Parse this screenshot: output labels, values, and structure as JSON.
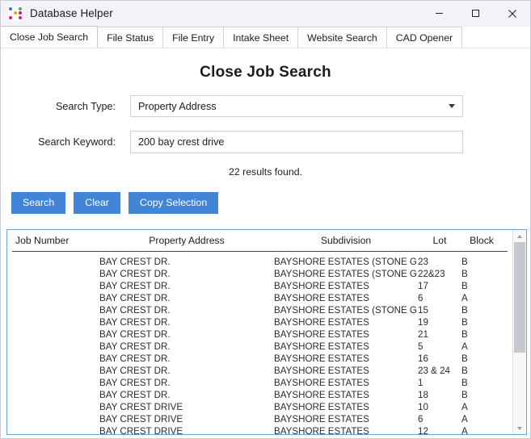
{
  "window": {
    "title": "Database Helper",
    "icon": "app-dots-icon",
    "icon_colors": [
      "#3a6fd8",
      "#ffffff",
      "#4caf50",
      "#f5f5f5",
      "#ff9800",
      "#9c27b0",
      "#e91e63",
      "#ffffff",
      "#e91e63"
    ],
    "controls": {
      "minimize": "minimize-icon",
      "maximize": "maximize-icon",
      "close": "close-icon"
    }
  },
  "tabs": [
    {
      "label": "Close Job Search",
      "active": true
    },
    {
      "label": "File Status",
      "active": false
    },
    {
      "label": "File Entry",
      "active": false
    },
    {
      "label": "Intake Sheet",
      "active": false
    },
    {
      "label": "Website Search",
      "active": false
    },
    {
      "label": "CAD Opener",
      "active": false
    }
  ],
  "page": {
    "title": "Close Job Search",
    "results_text": "22 results found."
  },
  "form": {
    "search_type": {
      "label": "Search Type:",
      "value": "Property Address",
      "caret": "chevron-down-icon"
    },
    "search_keyword": {
      "label": "Search Keyword:",
      "value": "200 bay crest drive",
      "placeholder": ""
    }
  },
  "buttons": {
    "search": "Search",
    "clear": "Clear",
    "copy_selection": "Copy Selection",
    "accent_color": "#4285d6"
  },
  "table": {
    "border_color": "#6ba3d6",
    "columns": [
      "Job Number",
      "Property Address",
      "Subdivision",
      "Lot",
      "Block"
    ],
    "rows": [
      {
        "job": "",
        "address": "BAY CREST DR.",
        "subdivision": "BAYSHORE ESTATES (STONE GR",
        "lot": "23",
        "block": "B"
      },
      {
        "job": "",
        "address": "BAY CREST DR.",
        "subdivision": "BAYSHORE ESTATES (STONE GR",
        "lot": "22&23",
        "block": "B"
      },
      {
        "job": "",
        "address": "BAY CREST DR.",
        "subdivision": "BAYSHORE ESTATES",
        "lot": "17",
        "block": "B"
      },
      {
        "job": "",
        "address": "BAY CREST DR.",
        "subdivision": "BAYSHORE ESTATES",
        "lot": "6",
        "block": "A"
      },
      {
        "job": "",
        "address": "BAY CREST DR.",
        "subdivision": "BAYSHORE ESTATES (STONE GR",
        "lot": "15",
        "block": "B"
      },
      {
        "job": "",
        "address": "BAY CREST DR.",
        "subdivision": "BAYSHORE ESTATES",
        "lot": "19",
        "block": "B"
      },
      {
        "job": "",
        "address": "BAY CREST DR.",
        "subdivision": "BAYSHORE ESTATES",
        "lot": "21",
        "block": "B"
      },
      {
        "job": "",
        "address": "BAY CREST DR.",
        "subdivision": "BAYSHORE ESTATES",
        "lot": "5",
        "block": "A"
      },
      {
        "job": "",
        "address": "BAY CREST DR.",
        "subdivision": "BAYSHORE ESTATES",
        "lot": "16",
        "block": "B"
      },
      {
        "job": "",
        "address": "BAY CREST DR.",
        "subdivision": "BAYSHORE ESTATES",
        "lot": "23 & 24",
        "block": "B"
      },
      {
        "job": "",
        "address": "BAY CREST DR.",
        "subdivision": "BAYSHORE ESTATES",
        "lot": "1",
        "block": "B"
      },
      {
        "job": "",
        "address": "BAY CREST DR.",
        "subdivision": "BAYSHORE ESTATES",
        "lot": "18",
        "block": "B"
      },
      {
        "job": "",
        "address": "BAY CREST DRIVE",
        "subdivision": "BAYSHORE ESTATES",
        "lot": "10",
        "block": "A"
      },
      {
        "job": "",
        "address": "BAY CREST DRIVE",
        "subdivision": "BAYSHORE ESTATES",
        "lot": "6",
        "block": "A"
      },
      {
        "job": "",
        "address": "BAY CREST DRIVE",
        "subdivision": "BAYSHORE ESTATES",
        "lot": "12",
        "block": "A"
      }
    ],
    "scrollbar": {
      "up_arrow": "scroll-up-icon",
      "down_arrow": "scroll-down-icon"
    }
  }
}
